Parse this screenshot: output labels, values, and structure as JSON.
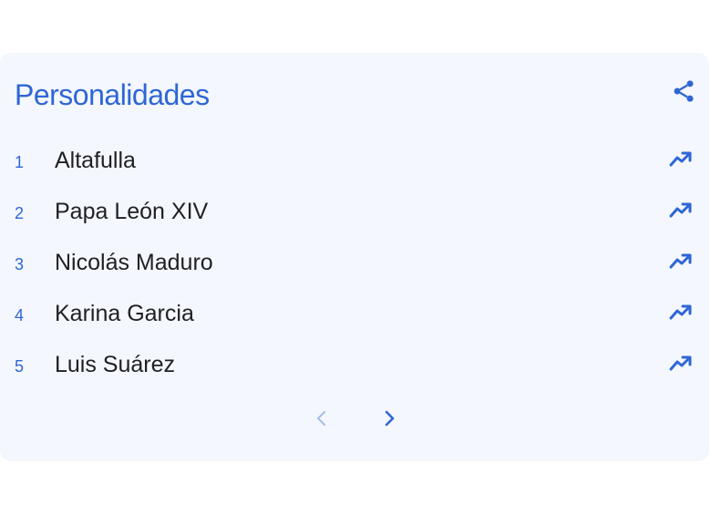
{
  "panel": {
    "title": "Personalidades"
  },
  "items": [
    {
      "rank": "1",
      "name": "Altafulla"
    },
    {
      "rank": "2",
      "name": "Papa León XIV"
    },
    {
      "rank": "3",
      "name": "Nicolás Maduro"
    },
    {
      "rank": "4",
      "name": "Karina Garcia"
    },
    {
      "rank": "5",
      "name": "Luis Suárez"
    }
  ],
  "icons": {
    "share": "share-icon",
    "trend": "trending-up-icon",
    "prev": "chevron-left-icon",
    "next": "chevron-right-icon"
  },
  "colors": {
    "accent": "#2f66d6",
    "card_bg": "#f4f7fd",
    "text": "#202124",
    "disabled": "#a9bce8"
  }
}
